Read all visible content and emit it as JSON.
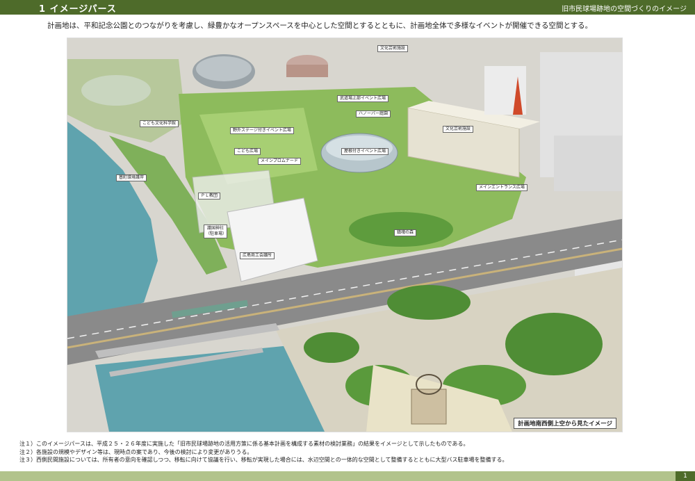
{
  "header": {
    "section": "1 イメージパース",
    "subtitle": "旧市民球場跡地の空間づくりのイメージ"
  },
  "intro": "計画地は、平和記念公園とのつながりを考慮し、緑豊かなオープンスペースを中心とした空間とするとともに、計画地全体で多様なイベントが開催できる空間とする。",
  "labels": {
    "culture_art_top": "文化芸術施設",
    "children_science": "こども文化科学館",
    "outdoor_stage": "野外ステージ付きイベント広場",
    "kids_plaza": "こども広場",
    "main_promenade": "メインプロムナード",
    "roofed_event": "屋根付きイベント広場",
    "hanover_garden": "ハノーバー庭園",
    "budokan_upper": "武道場上部イベント広場",
    "culture_art": "文化芸術施設",
    "main_entrance": "メインエントランス広場",
    "river_care": "基町環境護岸",
    "pl_church": "ＰＬ教団",
    "gokoku_shrine": "護国神社（駐車場）",
    "chamber_commerce": "広島商工会議所",
    "peace_forest": "鎮魂の森"
  },
  "caption": "計画地南西側上空から見たイメージ",
  "notes": [
    "注１）このイメージパースは、平成２５・２６年度に実施した「旧市民球場跡地の活用方策に係る基本計画を構成する素材の検討業務」の結果をイメージとして示したものである。",
    "注２）各施設の規模やデザイン等は、現時点の案であり、今後の検討により変更がありうる。",
    "注３）西側民間施設については、所有者の意向を確認しつつ、移転に向けて協議を行い、移転が実現した場合には、水辺空間との一体的な空間として整備するとともに大型バス駐車場を整備する。"
  ],
  "page_number": "1",
  "colors": {
    "header_bg": "#4e6b2a",
    "footer_bg": "#b2c38c",
    "water": "#5fa3ae",
    "park_green": "#6fa84a"
  }
}
